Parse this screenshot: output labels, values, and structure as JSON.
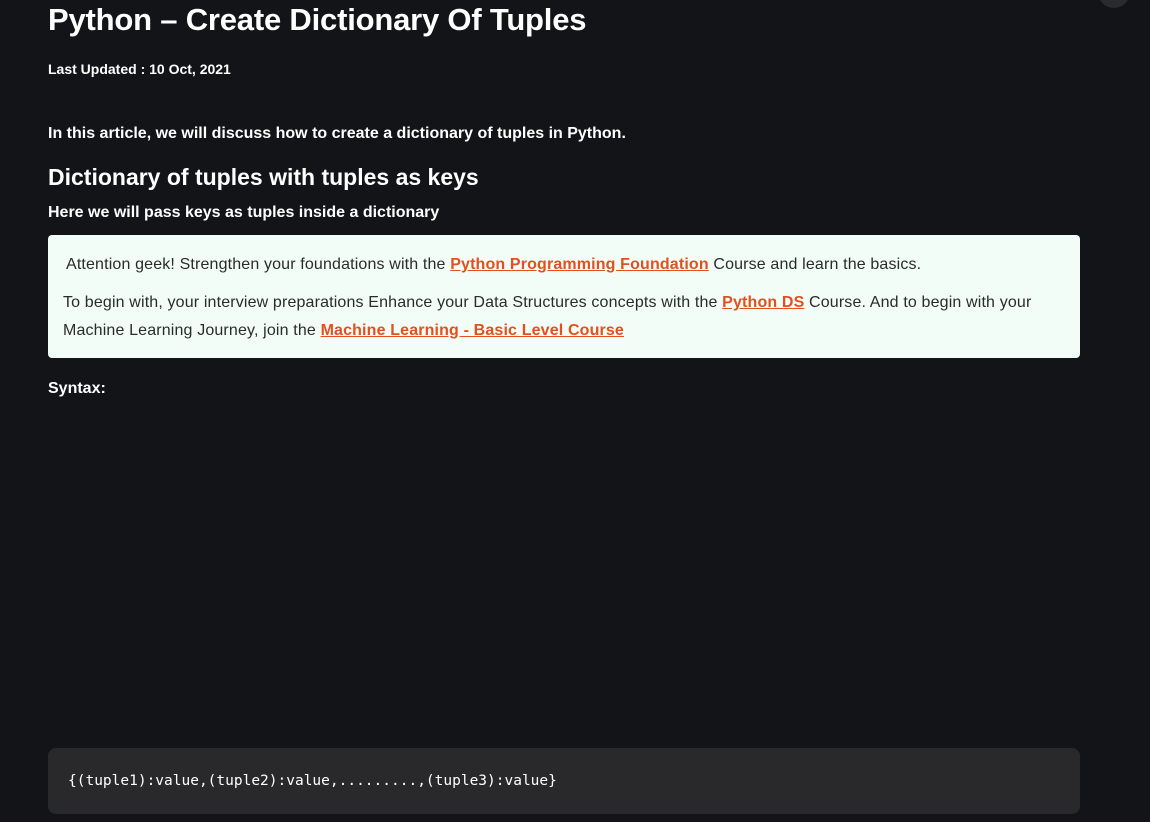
{
  "article": {
    "title": "Python – Create Dictionary Of Tuples",
    "last_updated": "Last Updated : 10 Oct, 2021",
    "intro": "In this article, we will discuss how to create a dictionary of tuples in Python.",
    "section_heading": "Dictionary of tuples with tuples as keys",
    "section_description": "Here we will pass keys as tuples inside a dictionary",
    "syntax_label": "Syntax:",
    "syntax_code": "{(tuple1):value,(tuple2):value,.........,(tuple3):value}"
  },
  "callout": {
    "line1_prefix": "Attention geek! Strengthen your foundations with the ",
    "line1_link": "Python Programming Foundation",
    "line1_suffix": " Course and learn the basics.",
    "line2_prefix": "To begin with, your interview preparations Enhance your Data Structures concepts with the ",
    "line2_link": "Python DS",
    "line2_middle": " Course. And to begin with your Machine Learning Journey, join the ",
    "line2_link2": "Machine Learning - Basic Level Course"
  },
  "colors": {
    "background": "#131417",
    "callout_background": "#f1fdf6",
    "link": "#e34f1f",
    "code_background": "#29292c"
  }
}
